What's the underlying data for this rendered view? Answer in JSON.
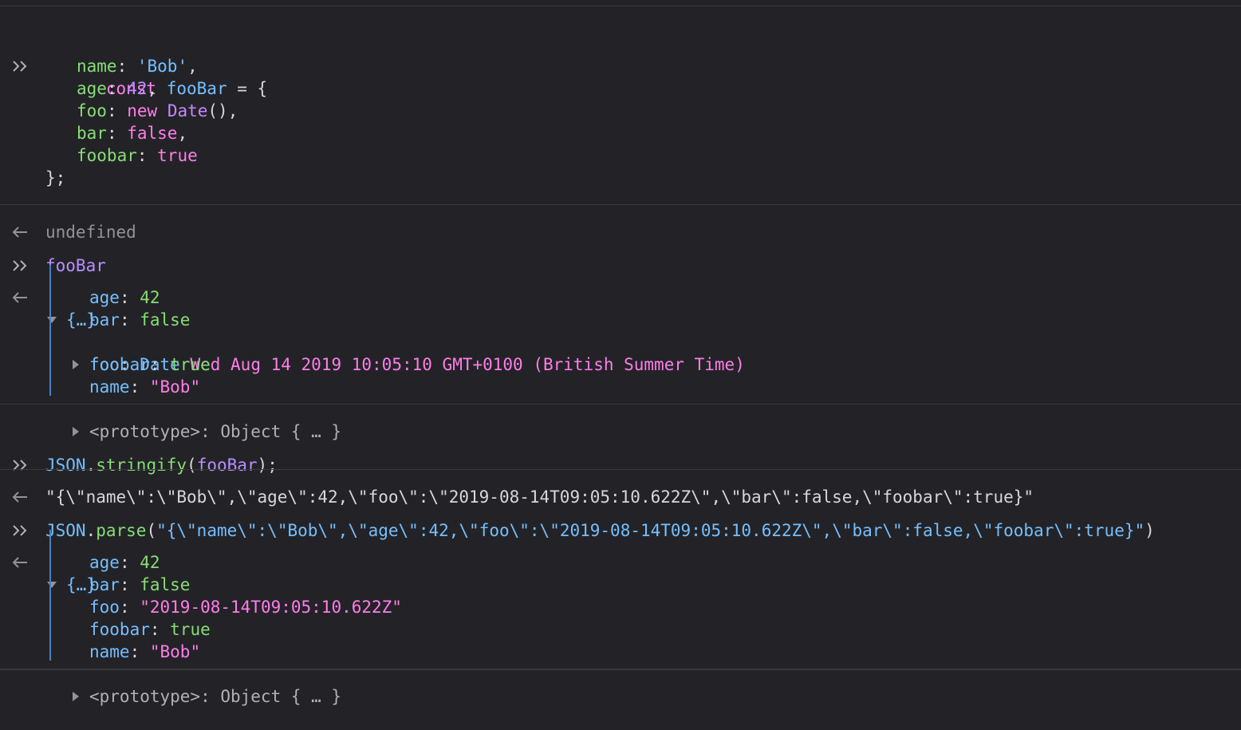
{
  "entry1": {
    "l1": {
      "kw": "const",
      "name": "fooBar",
      "rest": " = {"
    },
    "l2": {
      "key": "name",
      "colon": ": ",
      "val": "'Bob'",
      "end": ","
    },
    "l3": {
      "key": "age",
      "colon": ": ",
      "val": "42",
      "end": ","
    },
    "l4": {
      "key": "foo",
      "colon": ": ",
      "kw": "new",
      "cls": "Date",
      "end": "(),"
    },
    "l5": {
      "key": "bar",
      "colon": ": ",
      "val": "false",
      "end": ","
    },
    "l6": {
      "key": "foobar",
      "colon": ": ",
      "val": "true"
    },
    "l7": "};",
    "result": "undefined"
  },
  "entry2": {
    "input": "fooBar",
    "summary": "{…}",
    "props": [
      {
        "key": "age",
        "colon": ": ",
        "val": "42"
      },
      {
        "key": "bar",
        "colon": ": ",
        "val": "false"
      },
      {
        "key": "foo",
        "colon": ": ",
        "cls": "Date",
        "val": "Wed Aug 14 2019 10:05:10 GMT+0100 (British Summer Time)"
      },
      {
        "key": "foobar",
        "colon": ": ",
        "val": "true"
      },
      {
        "key": "name",
        "colon": ": ",
        "val": "\"Bob\""
      }
    ],
    "proto": "<prototype>: Object { … }"
  },
  "entry3": {
    "obj": "JSON",
    "dot": ".",
    "fn": "stringify",
    "open": "(",
    "arg": "fooBar",
    "close": ");",
    "result": "\"{\\\"name\\\":\\\"Bob\\\",\\\"age\\\":42,\\\"foo\\\":\\\"2019-08-14T09:05:10.622Z\\\",\\\"bar\\\":false,\\\"foobar\\\":true}\""
  },
  "entry4": {
    "obj": "JSON",
    "dot": ".",
    "fn": "parse",
    "open": "(",
    "arg": "\"{\\\"name\\\":\\\"Bob\\\",\\\"age\\\":42,\\\"foo\\\":\\\"2019-08-14T09:05:10.622Z\\\",\\\"bar\\\":false,\\\"foobar\\\":true}\"",
    "close": ")",
    "summary": "{…}",
    "props": [
      {
        "key": "age",
        "colon": ": ",
        "val": "42"
      },
      {
        "key": "bar",
        "colon": ": ",
        "val": "false"
      },
      {
        "key": "foo",
        "colon": ": ",
        "val": "\"2019-08-14T09:05:10.622Z\""
      },
      {
        "key": "foobar",
        "colon": ": ",
        "val": "true"
      },
      {
        "key": "name",
        "colon": ": ",
        "val": "\"Bob\""
      }
    ],
    "proto": "<prototype>: Object { … }"
  },
  "colors": {
    "background": "#232327",
    "accent_blue": "#75bfff",
    "pink": "#ff7de9",
    "green": "#86de74",
    "purple": "#b98eff"
  },
  "icons": {
    "prompt": "double-chevron-right-icon",
    "result": "arrow-left-icon",
    "expanded": "triangle-down-icon",
    "collapsed": "triangle-right-icon"
  }
}
